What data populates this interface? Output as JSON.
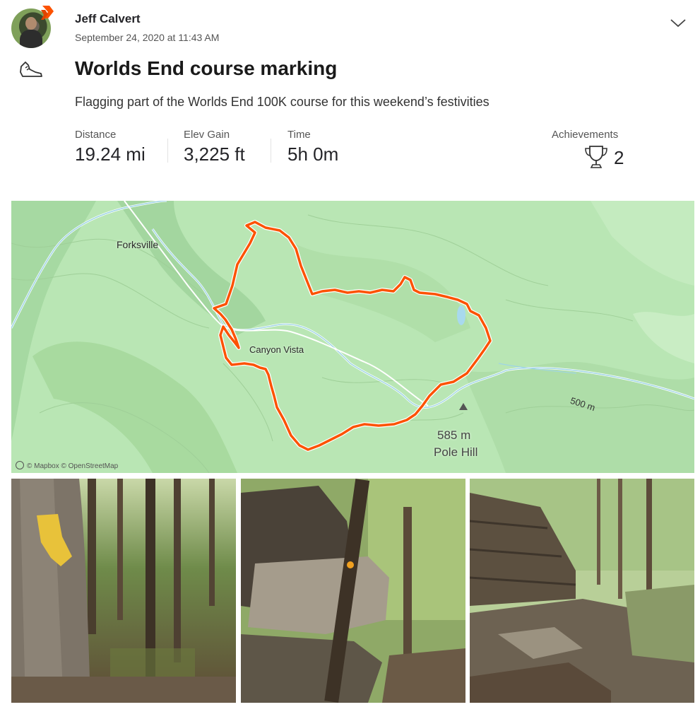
{
  "activity": {
    "athlete_name": "Jeff Calvert",
    "timestamp": "September 24, 2020 at 11:43 AM",
    "title": "Worlds End course marking",
    "description": "Flagging part of the Worlds End 100K course for this weekend’s festivities",
    "sport_icon": "shoe-icon"
  },
  "stats": [
    {
      "label": "Distance",
      "value": "19.24 mi"
    },
    {
      "label": "Elev Gain",
      "value": "3,225 ft"
    },
    {
      "label": "Time",
      "value": "5h 0m"
    }
  ],
  "achievements": {
    "label": "Achievements",
    "count": "2",
    "icon": "trophy-icon"
  },
  "map": {
    "labels": {
      "forksville": "Forksville",
      "canyon_vista": "Canyon Vista",
      "contour": "500 m",
      "peak_elevation": "585 m",
      "peak_name": "Pole Hill"
    },
    "attribution": "© Mapbox © OpenStreetMap",
    "route_color": "#fc5200",
    "land_color": "#b9e6b4",
    "water_color": "#cfeef5"
  },
  "photos": [
    {
      "name": "trail-marker-tree"
    },
    {
      "name": "rock-outcrop"
    },
    {
      "name": "rocky-creek"
    }
  ],
  "colors": {
    "brand": "#fc5200",
    "text": "#242428"
  }
}
